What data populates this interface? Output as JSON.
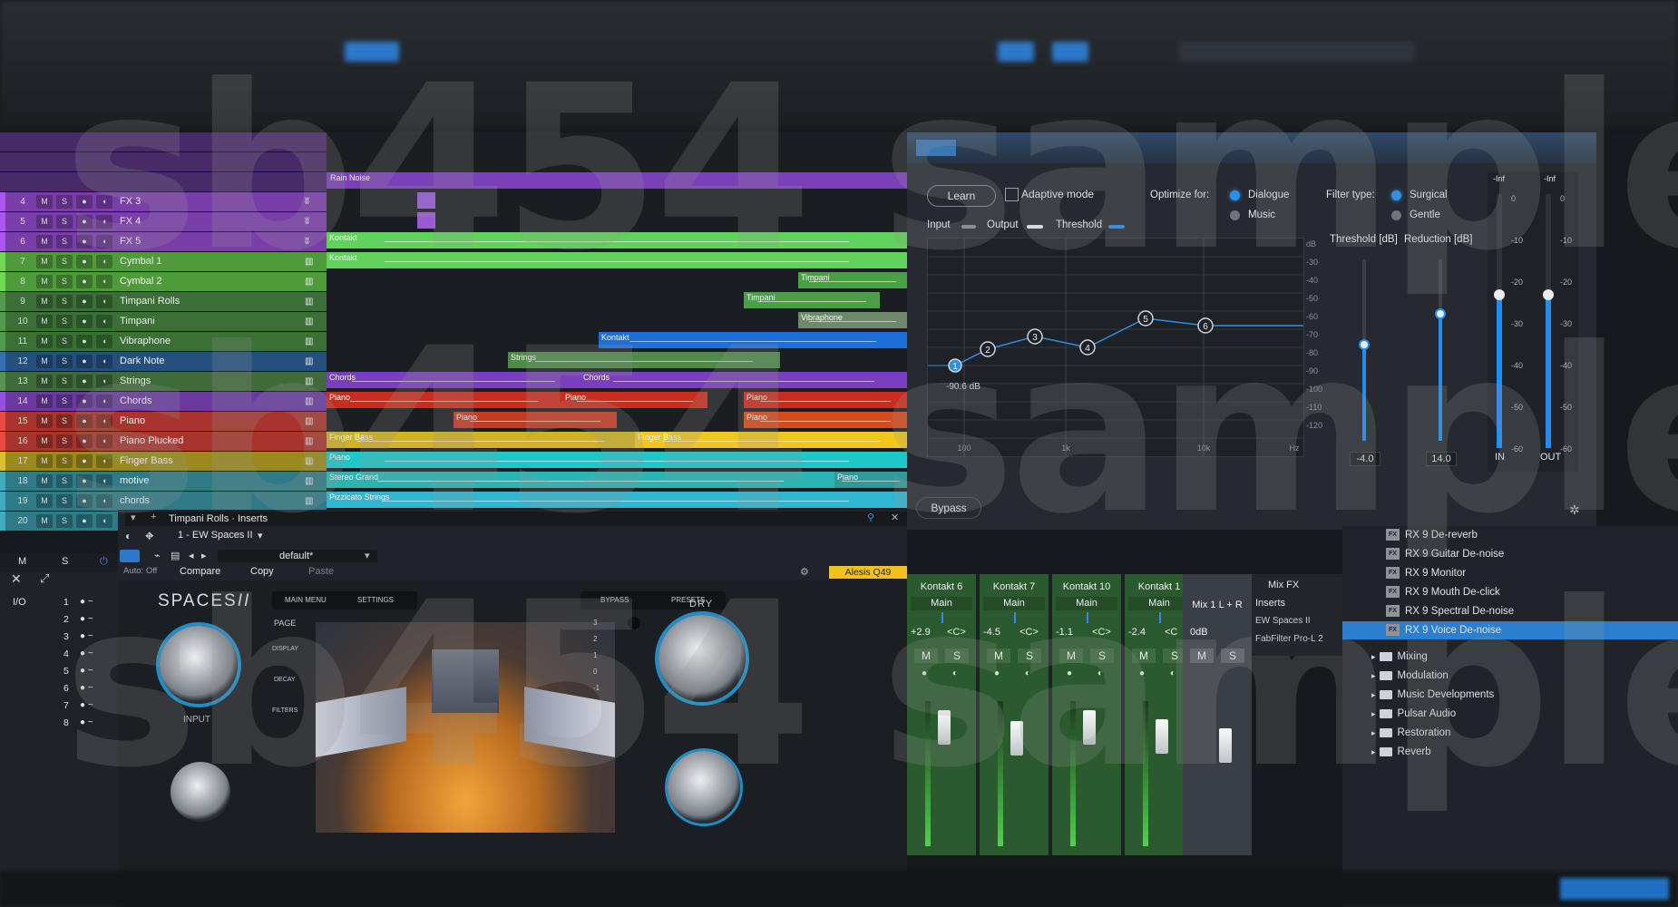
{
  "tracks": [
    {
      "n": "4",
      "name": "FX 3",
      "color": "#7a3ea8",
      "inst": "ʬ"
    },
    {
      "n": "5",
      "name": "FX 4",
      "color": "#7a3ea8",
      "inst": "ʬ"
    },
    {
      "n": "6",
      "name": "FX 5",
      "color": "#7a3ea8",
      "inst": "ʬ"
    },
    {
      "n": "7",
      "name": "Cymbal 1",
      "color": "#4f9a3b",
      "inst": "▥"
    },
    {
      "n": "8",
      "name": "Cymbal 2",
      "color": "#4f9a3b",
      "inst": "▥"
    },
    {
      "n": "9",
      "name": "Timpani Rolls",
      "color": "#3a6f36",
      "inst": "▥"
    },
    {
      "n": "10",
      "name": "Timpani",
      "color": "#3a6f36",
      "inst": "▥"
    },
    {
      "n": "11",
      "name": "Vibraphone",
      "color": "#3a6f36",
      "inst": "▥"
    },
    {
      "n": "12",
      "name": "Dark Note",
      "color": "#25507e",
      "inst": "▥"
    },
    {
      "n": "13",
      "name": "Strings",
      "color": "#3f6a3a",
      "inst": "▥"
    },
    {
      "n": "14",
      "name": "Chords",
      "color": "#6a3aa0",
      "inst": "▥"
    },
    {
      "n": "15",
      "name": "Piano",
      "color": "#a8352d",
      "inst": "▥"
    },
    {
      "n": "16",
      "name": "Piano Plucked",
      "color": "#a8352d",
      "inst": "▥"
    },
    {
      "n": "17",
      "name": "Finger Bass",
      "color": "#9a8a1e",
      "inst": "▥"
    },
    {
      "n": "18",
      "name": "motive",
      "color": "#2f7a86",
      "inst": "▥"
    },
    {
      "n": "19",
      "name": "chords",
      "color": "#2f7a86",
      "inst": "▥"
    },
    {
      "n": "20",
      "name": "Melody",
      "color": "#2f7a86",
      "inst": "▥"
    }
  ],
  "track_buttons": {
    "m": "M",
    "s": "S"
  },
  "events": [
    {
      "label": "Kontakt",
      "row": 3
    },
    {
      "label": "Kontakt",
      "row": 4
    },
    {
      "label": "Timpani",
      "row": 5
    },
    {
      "label": "Timpani",
      "row": 6
    },
    {
      "label": "Vibraphone",
      "row": 7
    },
    {
      "label": "Kontakt",
      "row": 8
    },
    {
      "label": "Strings",
      "row": 9
    },
    {
      "label": "Chords",
      "row": 10
    },
    {
      "label": "Chords",
      "row": 10
    },
    {
      "label": "Piano",
      "row": 11
    },
    {
      "label": "Piano",
      "row": 11
    },
    {
      "label": "Piano",
      "row": 11
    },
    {
      "label": "Piano",
      "row": 12
    },
    {
      "label": "Piano",
      "row": 12
    },
    {
      "label": "Finger Bass",
      "row": 13
    },
    {
      "label": "Finger Bass",
      "row": 13
    },
    {
      "label": "Piano",
      "row": 14
    },
    {
      "label": "Stereo Grand",
      "row": 15
    },
    {
      "label": "Piano",
      "row": 15
    },
    {
      "label": "Pizzicato Strings",
      "row": 16
    },
    {
      "label": "Rain Noise",
      "row": 0
    }
  ],
  "rx": {
    "learn": "Learn",
    "adaptive": "Adaptive mode",
    "optimize_for": "Optimize for:",
    "dialogue": "Dialogue",
    "music": "Music",
    "filter_type": "Filter type:",
    "surgical": "Surgical",
    "gentle": "Gentle",
    "input": "Input",
    "output": "Output",
    "threshold": "Threshold",
    "threshold_db": "Threshold [dB]",
    "reduction_db": "Reduction [dB]",
    "threshold_value": "-4.0",
    "reduction_value": "14.0",
    "readout": "-90.6 dB",
    "bypass": "Bypass",
    "db_labels": [
      "dB",
      "-30",
      "-40",
      "-50",
      "-60",
      "-70",
      "-80",
      "-90",
      "-100",
      "-110",
      "-120"
    ],
    "freq_labels": [
      "100",
      "1k",
      "10k",
      "Hz"
    ],
    "nodes": [
      "1",
      "2",
      "3",
      "4",
      "5",
      "6"
    ],
    "meter_top": [
      "-Inf",
      "-Inf"
    ],
    "meter_scale": [
      "0",
      "-10",
      "-20",
      "-30",
      "-40",
      "-50",
      "-60"
    ],
    "in": "IN",
    "out": "OUT"
  },
  "editor": {
    "track_title": "Timpani Rolls · Inserts",
    "plugin": "1 - EW Spaces II",
    "preset": "default*",
    "auto": "Auto: Off",
    "compare": "Compare",
    "copy": "Copy",
    "paste": "Paste",
    "device": "Alesis Q49"
  },
  "spaces": {
    "logo": "SPACES",
    "logo2": "II",
    "main_menu": "MAIN MENU",
    "settings": "SETTINGS",
    "bypass": "BYPASS",
    "presets": "PRESETS",
    "page": "PAGE",
    "display": "DISPLAY",
    "decay": "DECAY",
    "filters": "FILTERS",
    "input": "INPUT",
    "dry": "DRY",
    "scale": [
      "3",
      "2",
      "1",
      "0",
      "-1",
      "-2",
      "-3"
    ]
  },
  "io": {
    "io_label": "I/O",
    "rows": [
      "1",
      "2",
      "3",
      "4",
      "5",
      "6",
      "7",
      "8"
    ],
    "m": "M",
    "s": "S"
  },
  "mixer": {
    "strips": [
      {
        "name": "Kontakt 6",
        "main": "Main",
        "val": "+2.9",
        "pan": "<C>"
      },
      {
        "name": "Kontakt 7",
        "main": "Main",
        "val": "-4.5",
        "pan": "<C>"
      },
      {
        "name": "Kontakt 10",
        "main": "Main",
        "val": "-1.1",
        "pan": "<C>"
      },
      {
        "name": "Kontakt 1",
        "main": "Main",
        "val": "-2.4",
        "pan": "<C"
      }
    ],
    "mix": {
      "name": "Mix 1 L + R",
      "val": "0dB"
    },
    "fx_title": "Mix FX",
    "inserts": "Inserts",
    "insert_items": [
      "EW Spaces II",
      "FabFilter Pro-L 2"
    ],
    "m": "M",
    "s": "S"
  },
  "browser": {
    "fx_items": [
      "RX 9 De-reverb",
      "RX 9 Guitar De-noise",
      "RX 9 Monitor",
      "RX 9 Mouth De-click",
      "RX 9 Spectral De-noise",
      "RX 9 Voice De-noise"
    ],
    "selected": "RX 9 Voice De-noise",
    "folders": [
      "Mixing",
      "Modulation",
      "Music Developments",
      "Pulsar Audio",
      "Restoration",
      "Reverb"
    ]
  },
  "watermark": [
    "sb454 sample",
    "sb454 sample",
    "sb454 sample"
  ],
  "colors": {
    "accent": "#1f8ef0",
    "selection": "#2a7fd0",
    "yellow": "#f3c21f"
  }
}
